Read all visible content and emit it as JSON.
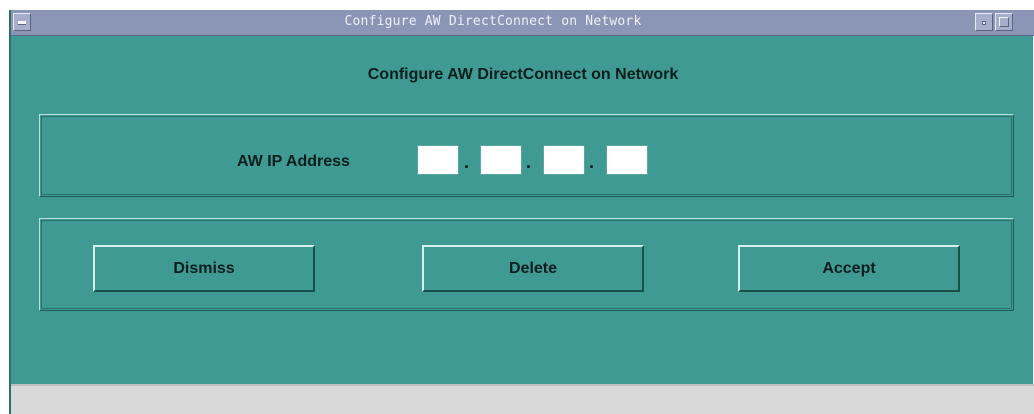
{
  "window": {
    "title": "Configure AW DirectConnect on Network",
    "menu_icon": "window-menu-icon",
    "minimize_icon": "minimize-icon",
    "maximize_icon": "maximize-icon"
  },
  "dialog": {
    "heading": "Configure AW DirectConnect on Network",
    "ip_label": "AW IP Address",
    "ip_octets": [
      "",
      "",
      "",
      ""
    ],
    "separator": "."
  },
  "buttons": {
    "dismiss": "Dismiss",
    "delete": "Delete",
    "accept": "Accept"
  },
  "colors": {
    "background": "#3f9a94",
    "titlebar": "#8b95b6",
    "statusbar": "#d9d9d9"
  }
}
